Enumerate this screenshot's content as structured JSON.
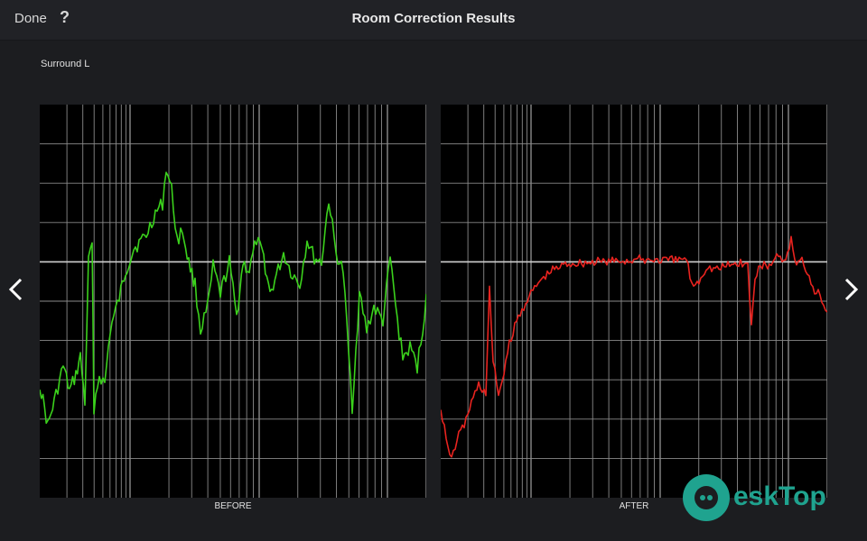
{
  "header": {
    "done_label": "Done",
    "help_label": "?",
    "title": "Room Correction Results"
  },
  "channel": {
    "label": "Surround L"
  },
  "navigation": {
    "prev_icon": "chevron-left-icon",
    "next_icon": "chevron-right-icon"
  },
  "graphs": {
    "before": {
      "caption": "BEFORE",
      "line_color": "#3bd11c"
    },
    "after": {
      "caption": "AFTER",
      "line_color": "#e8231f"
    },
    "grid_color": "#8a8a8a",
    "reference_line_color": "#cfcfcf"
  },
  "watermark": {
    "text": "eskTop",
    "color": "#1fa38f"
  }
}
